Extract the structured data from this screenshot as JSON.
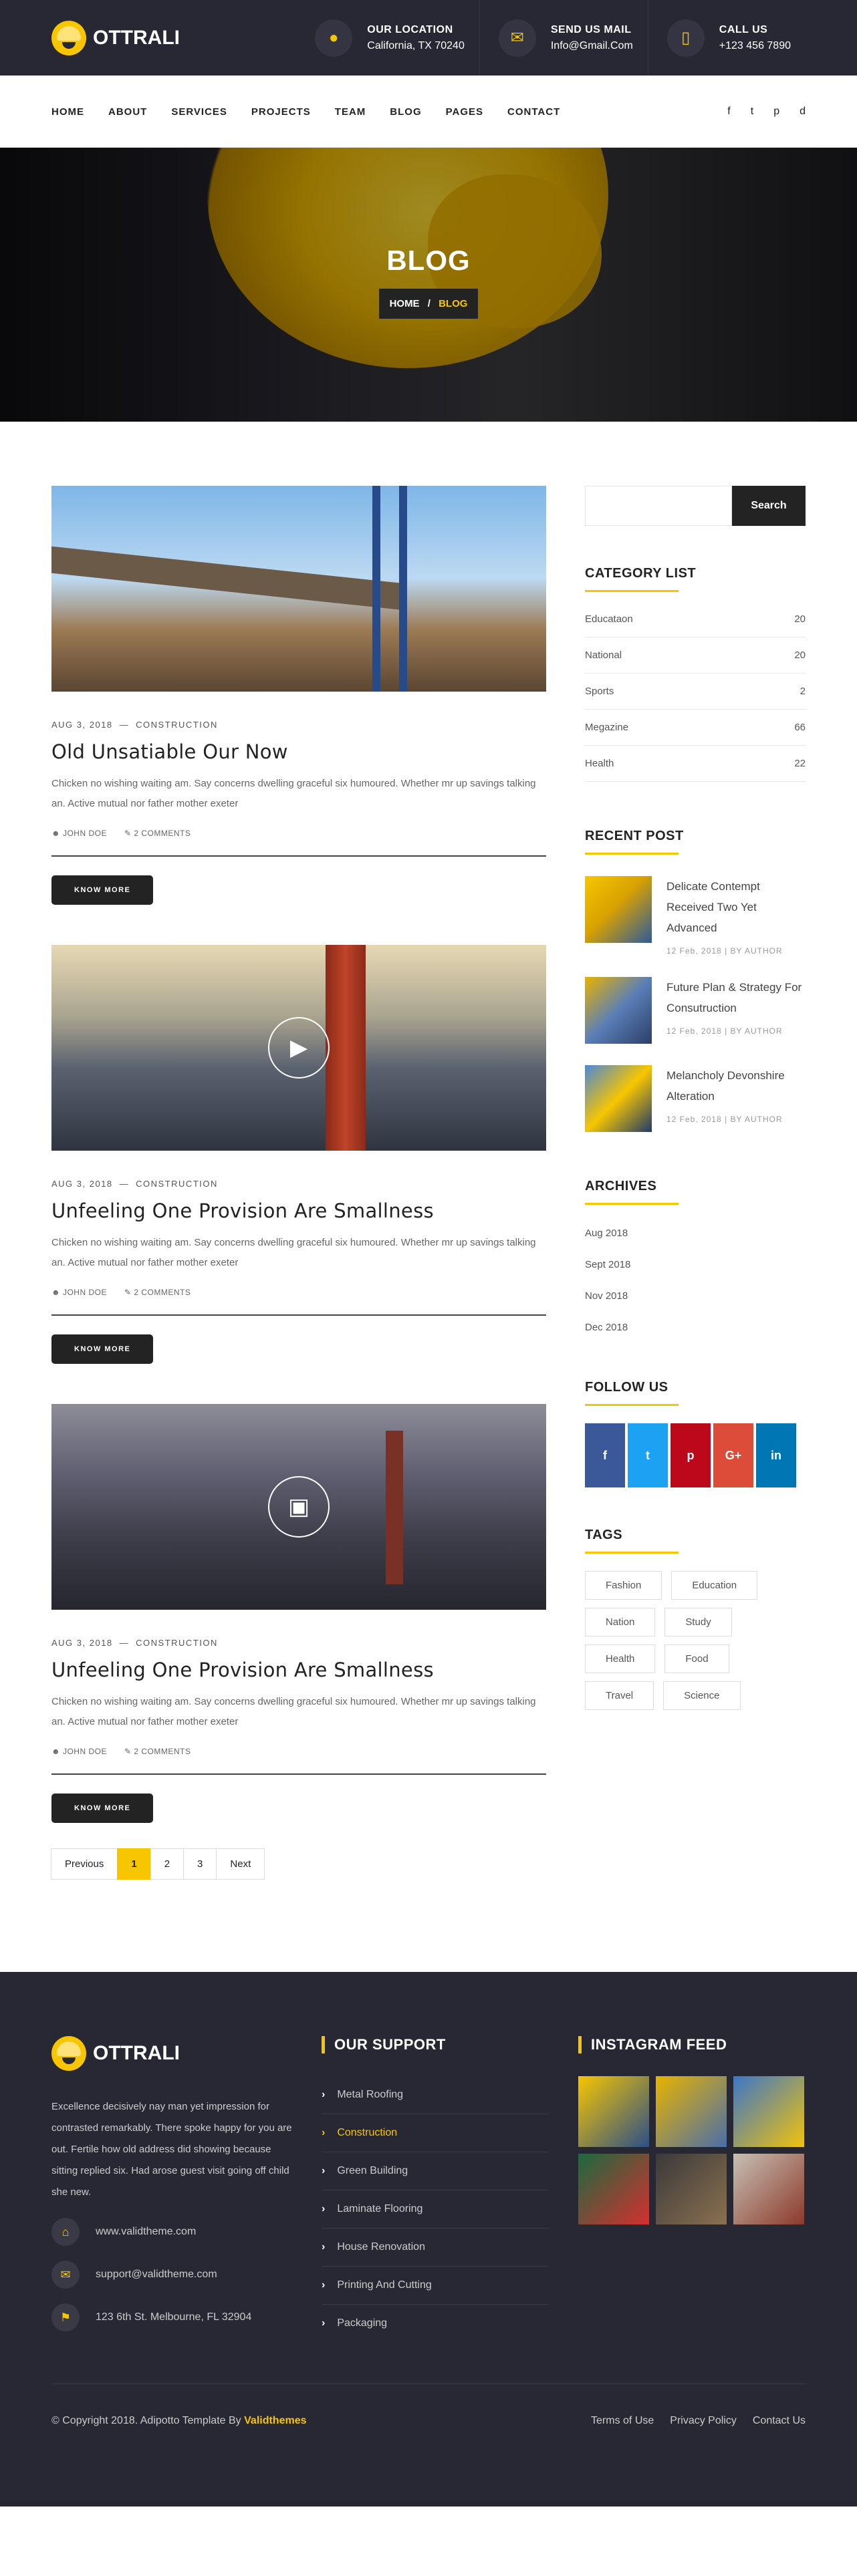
{
  "brand": {
    "name": "OTTRALI"
  },
  "topbar": {
    "location": {
      "title": "OUR LOCATION",
      "value": "California, TX 70240"
    },
    "mail": {
      "title": "SEND US MAIL",
      "value": "Info@Gmail.Com"
    },
    "call": {
      "title": "CALL US",
      "value": "+123 456 7890"
    }
  },
  "nav": {
    "items": [
      "HOME",
      "ABOUT",
      "SERVICES",
      "PROJECTS",
      "TEAM",
      "BLOG",
      "PAGES",
      "CONTACT"
    ],
    "social": [
      "f",
      "t",
      "p",
      "d"
    ]
  },
  "banner": {
    "title": "BLOG",
    "crumb_home": "HOME",
    "crumb_sep": "/",
    "crumb_current": "BLOG"
  },
  "posts": [
    {
      "date": "AUG 3, 2018",
      "category": "CONSTRUCTION",
      "title": "Old Unsatiable Our Now",
      "excerpt": "Chicken no wishing waiting am. Say concerns dwelling graceful six humoured. Whether mr up savings talking an. Active mutual nor father mother exeter",
      "author": "JOHN DOE",
      "comments": "2 COMMENTS",
      "button": "KNOW MORE"
    },
    {
      "date": "AUG 3, 2018",
      "category": "CONSTRUCTION",
      "title": "Unfeeling One Provision Are Smallness",
      "excerpt": "Chicken no wishing waiting am. Say concerns dwelling graceful six humoured. Whether mr up savings talking an. Active mutual nor father mother exeter",
      "author": "JOHN DOE",
      "comments": "2 COMMENTS",
      "button": "KNOW MORE",
      "media_icon": "video-icon"
    },
    {
      "date": "AUG 3, 2018",
      "category": "CONSTRUCTION",
      "title": "Unfeeling One Provision Are Smallness",
      "excerpt": "Chicken no wishing waiting am. Say concerns dwelling graceful six humoured. Whether mr up savings talking an. Active mutual nor father mother exeter",
      "author": "JOHN DOE",
      "comments": "2 COMMENTS",
      "button": "KNOW MORE",
      "media_icon": "gallery-icon"
    }
  ],
  "pagination": {
    "prev": "Previous",
    "pages": [
      "1",
      "2",
      "3"
    ],
    "next": "Next",
    "current": "1"
  },
  "sidebar": {
    "search": {
      "placeholder": "",
      "button": "Search"
    },
    "category_title": "CATEGORY LIST",
    "categories": [
      {
        "name": "Educataon",
        "count": "20"
      },
      {
        "name": "National",
        "count": "20"
      },
      {
        "name": "Sports",
        "count": "2"
      },
      {
        "name": "Megazine",
        "count": "66"
      },
      {
        "name": "Health",
        "count": "22"
      }
    ],
    "recent_title": "RECENT POST",
    "recent": [
      {
        "title": "Delicate Contempt Received Two Yet Advanced",
        "date": "12 Feb, 2018",
        "by": "| BY AUTHOR"
      },
      {
        "title": "Future Plan & Strategy For Consutruction",
        "date": "12 Feb, 2018",
        "by": "| BY AUTHOR"
      },
      {
        "title": "Melancholy Devonshire Alteration",
        "date": "12 Feb, 2018",
        "by": "| BY AUTHOR"
      }
    ],
    "archives_title": "ARCHIVES",
    "archives": [
      "Aug 2018",
      "Sept 2018",
      "Nov 2018",
      "Dec 2018"
    ],
    "follow_title": "FOLLOW US",
    "follow": [
      {
        "label": "f",
        "color": "#3b5998"
      },
      {
        "label": "t",
        "color": "#1da1f2"
      },
      {
        "label": "p",
        "color": "#bd081c"
      },
      {
        "label": "G+",
        "color": "#dd4b39"
      },
      {
        "label": "in",
        "color": "#0077b5"
      }
    ],
    "tags_title": "TAGS",
    "tags": [
      "Fashion",
      "Education",
      "Nation",
      "Study",
      "Health",
      "Food",
      "Travel",
      "Science"
    ]
  },
  "footer": {
    "about": "Excellence decisively nay man yet impression for contrasted remarkably. There spoke happy for you are out. Fertile how old address did showing because sitting replied six. Had arose guest visit going off child she new.",
    "website": "www.validtheme.com",
    "email": "support@validtheme.com",
    "address": "123 6th St. Melbourne, FL 32904",
    "support_title": "OUR SUPPORT",
    "support_links": [
      "Metal Roofing",
      "Construction",
      "Green Building",
      "Laminate Flooring",
      "House Renovation",
      "Printing And Cutting",
      "Packaging"
    ],
    "instagram_title": "INSTAGRAM FEED",
    "copyright": "© Copyright 2018. Adipotto Template By",
    "copyright_brand": "Validthemes",
    "bottom_links": [
      "Terms of Use",
      "Privacy Policy",
      "Contact Us"
    ]
  },
  "colors": {
    "accent": "#f7c600",
    "dark": "#282834"
  }
}
